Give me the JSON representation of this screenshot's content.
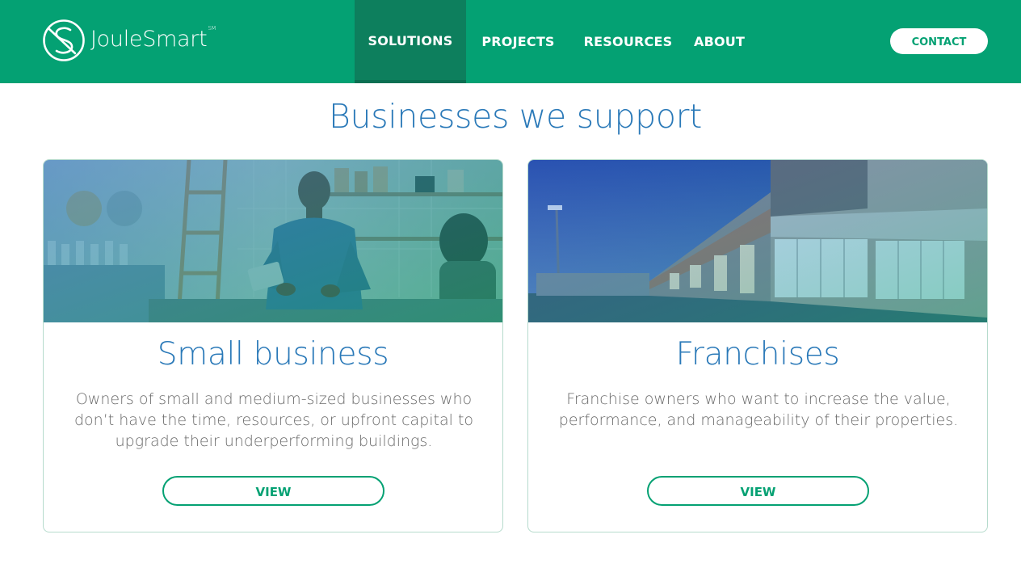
{
  "header": {
    "logo_text": "JouleSmart",
    "logo_mark": "SM",
    "nav": [
      {
        "label": "SOLUTIONS",
        "active": true
      },
      {
        "label": "PROJECTS",
        "active": false
      },
      {
        "label": "RESOURCES",
        "active": false
      },
      {
        "label": "ABOUT",
        "active": false
      }
    ],
    "contact_label": "CONTACT"
  },
  "main": {
    "title": "Businesses we support",
    "cards": [
      {
        "title": "Small business",
        "description": "Owners of small and medium-sized businesses who don’t have the time, resources, or upfront capital to upgrade their underperforming buildings.",
        "button_label": "VIEW",
        "image": "man-with-tablet-in-cafe-photo"
      },
      {
        "title": "Franchises",
        "description": "Franchise owners who want to increase the value, performance, and manageability of their properties.",
        "button_label": "VIEW",
        "image": "retail-strip-mall-at-dusk-photo"
      }
    ]
  },
  "colors": {
    "brand_green": "#04a173",
    "nav_active": "#0d7f5d",
    "heading_blue": "#2a79b8",
    "body_text": "#6a6a6a"
  }
}
